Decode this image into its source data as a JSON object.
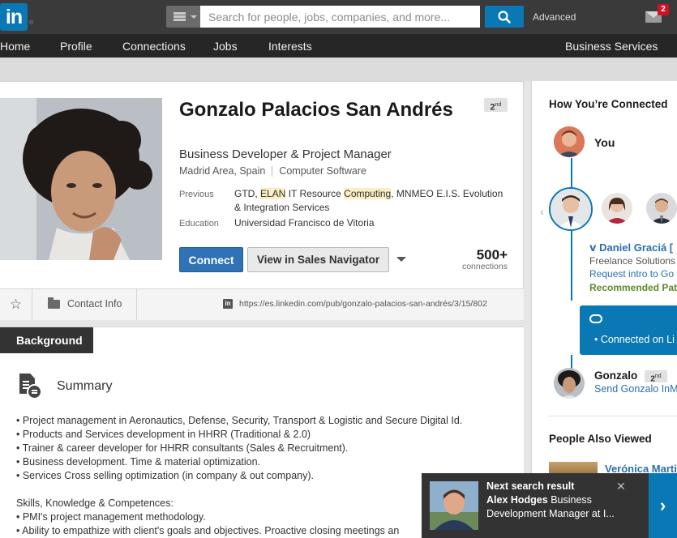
{
  "topbar": {
    "logo_text": "in",
    "logo_reg": "®",
    "search_placeholder": "Search for people, jobs, companies, and more...",
    "advanced_label": "Advanced",
    "mail_badge": "2"
  },
  "nav": {
    "items": [
      "Home",
      "Profile",
      "Connections",
      "Jobs",
      "Interests"
    ],
    "business": "Business Services"
  },
  "profile": {
    "name": "Gonzalo Palacios San Andrés",
    "headline": "Business Developer & Project Manager",
    "location": "Madrid Area, Spain",
    "industry": "Computer Software",
    "degree": "2",
    "degree_suffix": "nd",
    "previous_label": "Previous",
    "previous": {
      "part1": "GTD, ",
      "hl1": "ELAN",
      "part2": " IT Resource ",
      "hl2": "Computing",
      "part3": ", MNMEO E.I.S. Evolution",
      "line2": "& Integration Services"
    },
    "education_label": "Education",
    "education": "Universidad Francisco de Vitoria",
    "connect_label": "Connect",
    "sales_label": "View in Sales Navigator",
    "connections_count": "500+",
    "connections_label": "connections",
    "contact_label": "Contact Info",
    "star_glyph": "☆",
    "public_url": "https://es.linkedin.com/pub/gonzalo-palacios-san-andrés/3/15/802"
  },
  "background": {
    "tab_label": "Background",
    "summary_title": "Summary",
    "lines": [
      "• Project management in Aeronautics, Defense, Security, Transport & Logistic and Secure Digital Id.",
      "• Products and Services development in HHRR (Traditional & 2.0)",
      "• Trainer & career developer for HHRR consultants (Sales & Recruitment).",
      "• Business development. Time & material optimization.",
      "• Services Cross selling optimization (in company & out company).",
      "",
      "Skills, Knowledge & Competences:",
      "• PMI's project management methodology.",
      "• Ability to empathize with client's goals and objectives. Proactive closing meetings an"
    ]
  },
  "right": {
    "title": "How You’re Connected",
    "you_label": "You",
    "middle_name": "Daniel Graciá [",
    "middle_line1": "Freelance Solutions",
    "middle_line2": "Request intro to Go",
    "middle_line3": "Recommended Pat",
    "connected_on": "• Connected on Li",
    "target_name": "Gonzalo",
    "target_degree": "2",
    "target_degree_suffix": "nd",
    "send_label": "Send Gonzalo InM",
    "also_viewed_title": "People Also Viewed",
    "also_viewed_name": "Verónica Marti"
  },
  "toast": {
    "heading": "Next search result",
    "name": "Alex Hodges",
    "title_rest": " Business Development Manager at I...",
    "close": "✕",
    "next": "›"
  },
  "colors": {
    "accent": "#0a78b5",
    "connect_button": "#2f72b5",
    "topbar": "#3a3a3a",
    "navbar": "#262626",
    "link": "#2a6fb0",
    "recommended": "#5a8a2a",
    "highlight": "#fbeec2"
  }
}
